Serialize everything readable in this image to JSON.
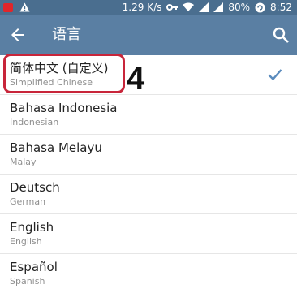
{
  "status_bar": {
    "speed": "1.29 K/s",
    "battery": "80%",
    "time": "8:52"
  },
  "app_bar": {
    "title": "语言",
    "back_icon": "arrow-left-icon",
    "search_icon": "search-icon"
  },
  "annotation": {
    "step_number": "4"
  },
  "languages": [
    {
      "name": "简体中文 (自定义)",
      "native": "Simplified Chinese",
      "selected": true
    },
    {
      "name": "Bahasa Indonesia",
      "native": "Indonesian",
      "selected": false
    },
    {
      "name": "Bahasa Melayu",
      "native": "Malay",
      "selected": false
    },
    {
      "name": "Deutsch",
      "native": "German",
      "selected": false
    },
    {
      "name": "English",
      "native": "English",
      "selected": false
    },
    {
      "name": "Español",
      "native": "Spanish",
      "selected": false
    }
  ],
  "colors": {
    "app_bar": "#5a7fa3",
    "status_bar": "#4a6e8f",
    "check": "#5a8bbd",
    "highlight": "#c8253a"
  }
}
